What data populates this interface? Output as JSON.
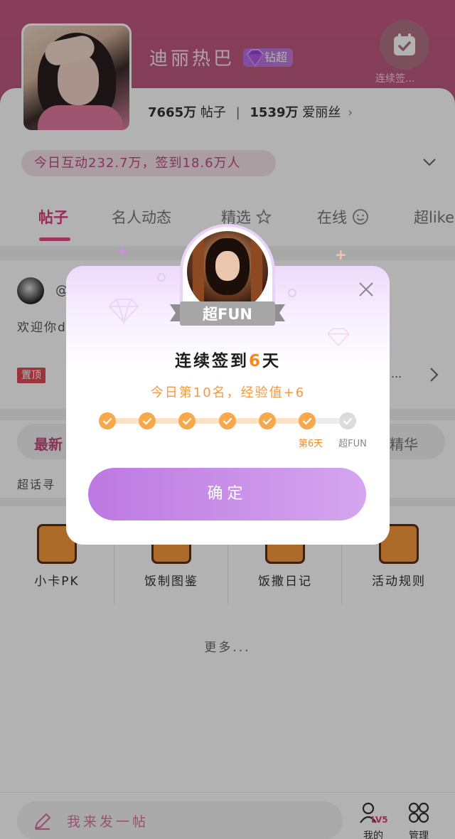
{
  "header": {
    "name": "迪丽热巴",
    "badge_label": "钻超",
    "checkin_label": "连续签...",
    "stats": {
      "posts_value": "7665",
      "posts_unit": "万",
      "posts_label": "帖子",
      "fans_value": "1539",
      "fans_unit": "万",
      "fans_label": "爱丽丝",
      "fans_chevron": "›"
    },
    "interaction_text": "今日互动232.7万，签到18.6万人"
  },
  "tabs": [
    {
      "label": "帖子",
      "active": true
    },
    {
      "label": "名人动态"
    },
    {
      "label": "精选"
    },
    {
      "label": "在线"
    },
    {
      "label": "超like"
    }
  ],
  "post": {
    "at_text": "@",
    "welcome_text": "欢迎你di",
    "pin_label": "置顶",
    "ellipsis": "..."
  },
  "filter": {
    "latest": "最新",
    "essence": "精华"
  },
  "guide_text": "超话寻",
  "tools": [
    {
      "label": "小卡PK"
    },
    {
      "label": "饭制图鉴"
    },
    {
      "label": "饭撒日记"
    },
    {
      "label": "活动规则"
    }
  ],
  "more_text": "更多...",
  "bottom": {
    "compose_placeholder": "我来发一帖",
    "mine_label": "我的",
    "level": "LV5",
    "manage_label": "管理"
  },
  "dialog": {
    "ribbon_label": "超FUN",
    "title_prefix": "连续签到",
    "title_days": "6",
    "title_suffix": "天",
    "subtitle": "今日第10名，经验值+6",
    "steps_done": 6,
    "steps_total": 7,
    "current_step_label": "第6天",
    "final_step_label": "超FUN",
    "confirm_label": "确定"
  },
  "colors": {
    "accent_pink": "#d83f7a",
    "orange": "#f5871f",
    "purple": "#bd79e2"
  }
}
